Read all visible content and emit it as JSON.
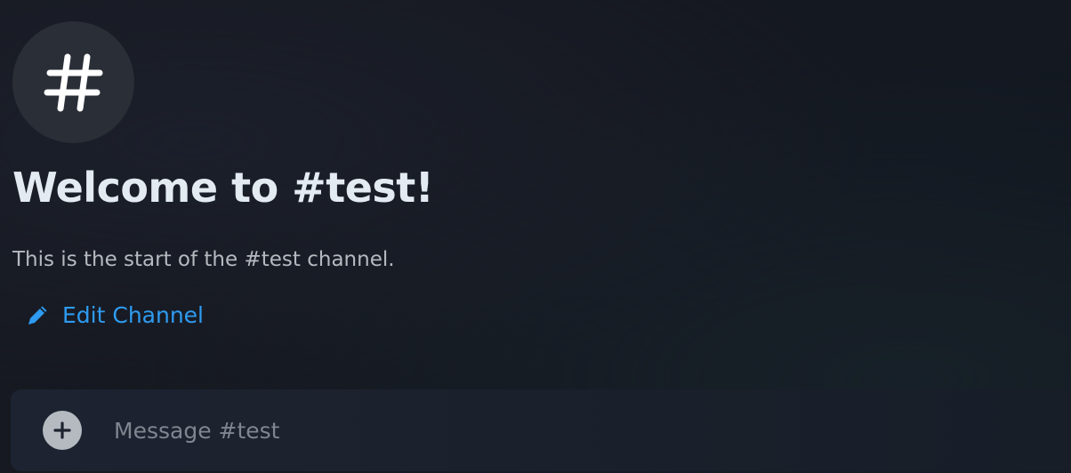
{
  "channel": {
    "icon": "hash-icon",
    "welcome_title": "Welcome to #test!",
    "welcome_subtitle": "This is the start of the #test channel.",
    "edit_channel_icon": "pencil-icon",
    "edit_channel_label": "Edit Channel"
  },
  "composer": {
    "attach_icon": "plus-icon",
    "placeholder": "Message #test",
    "value": ""
  },
  "colors": {
    "background": "#151820",
    "accent_link": "#2e9bf0",
    "title_text": "#e3eaf2",
    "subtitle_text": "#b5bac1"
  }
}
